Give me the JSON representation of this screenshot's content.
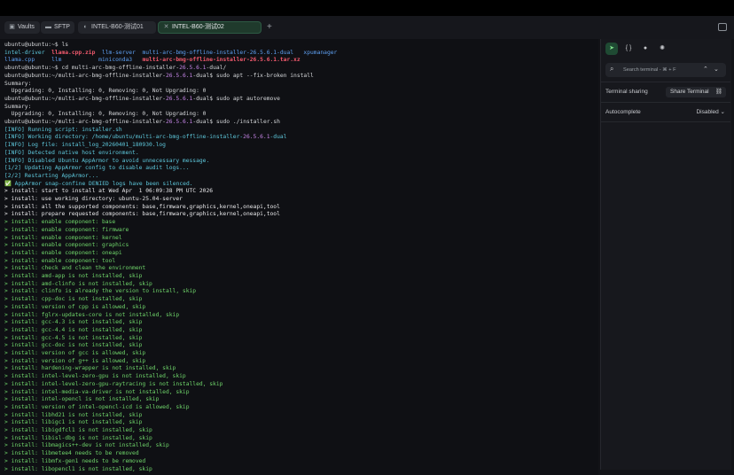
{
  "tabs": [
    {
      "icon": "vault-icon",
      "glyph": "▣",
      "label": "Vaults"
    },
    {
      "icon": "folder-icon",
      "glyph": "▬",
      "label": "SFTP"
    },
    {
      "icon": "terminal-icon",
      "glyph": "◐",
      "label": "INTEL-B60-测试01"
    },
    {
      "icon": "close-icon",
      "glyph": "✕",
      "label": "INTEL-B60-测试02"
    }
  ],
  "new_tab_glyph": "+",
  "terminal": {
    "lines": [
      [
        {
          "t": "ubuntu@ubuntu:~$ ls",
          "c": ""
        }
      ],
      [
        {
          "t": "intel-driver  ",
          "c": "c"
        },
        {
          "t": "llama.cpp.zip",
          "c": "r"
        },
        {
          "t": "  llm-server  ",
          "c": "b"
        },
        {
          "t": "multi-arc-bmg-offline-installer-26.5.6.1-dual",
          "c": "b"
        },
        {
          "t": "   xpumanager",
          "c": "b"
        }
      ],
      [
        {
          "t": "llama.cpp     ",
          "c": "b"
        },
        {
          "t": "llm",
          "c": "b"
        },
        {
          "t": "           miniconda3   ",
          "c": "b"
        },
        {
          "t": "multi-arc-bmg-offline-installer-26.5.6.1.tar.xz",
          "c": "r"
        }
      ],
      [
        {
          "t": "ubuntu@ubuntu:~$ cd multi-arc-bmg-offline-installer-",
          "c": ""
        },
        {
          "t": "26.5.6.1",
          "c": "m"
        },
        {
          "t": "-dual/",
          "c": ""
        }
      ],
      [
        {
          "t": "ubuntu@ubuntu:~/multi-arc-bmg-offline-installer-",
          "c": ""
        },
        {
          "t": "26.5.6.1",
          "c": "m"
        },
        {
          "t": "-dual$ sudo apt --fix-broken install",
          "c": ""
        }
      ],
      [
        {
          "t": "Summary:",
          "c": ""
        }
      ],
      [
        {
          "t": "  Upgrading: 0, Installing: 0, Removing: 0, Not Upgrading: 0",
          "c": ""
        }
      ],
      [
        {
          "t": "ubuntu@ubuntu:~/multi-arc-bmg-offline-installer-",
          "c": ""
        },
        {
          "t": "26.5.6.1",
          "c": "m"
        },
        {
          "t": "-dual$ sudo apt autoremove",
          "c": ""
        }
      ],
      [
        {
          "t": "Summary:",
          "c": ""
        }
      ],
      [
        {
          "t": "  Upgrading: 0, Installing: 0, Removing: 0, Not Upgrading: 0",
          "c": ""
        }
      ],
      [
        {
          "t": "ubuntu@ubuntu:~/multi-arc-bmg-offline-installer-",
          "c": ""
        },
        {
          "t": "26.5.6.1",
          "c": "m"
        },
        {
          "t": "-dual$ sudo ./installer.sh",
          "c": ""
        }
      ],
      [
        {
          "t": "[INFO] Running script: installer.sh",
          "c": "c"
        }
      ],
      [
        {
          "t": "[INFO] Working directory: /home/ubuntu/multi-arc-bmg-offline-installer-",
          "c": "c"
        },
        {
          "t": "26.5.6.1",
          "c": "m"
        },
        {
          "t": "-dual",
          "c": "c"
        }
      ],
      [
        {
          "t": "[INFO] Log file: install_log_20260401_180930.log",
          "c": "c"
        }
      ],
      [
        {
          "t": "[INFO] Detected native host environment.",
          "c": "c"
        }
      ],
      [
        {
          "t": "[INFO] Disabled Ubuntu AppArmor to avoid unnecessary message.",
          "c": "c"
        }
      ],
      [
        {
          "t": "[1/2] Updating AppArmor config to disable audit logs...",
          "c": "c"
        }
      ],
      [
        {
          "t": "[2/2] Restarting AppArmor...",
          "c": "c"
        }
      ],
      [
        {
          "t": "✅ AppArmor snap-confine DENIED logs have been silenced.",
          "c": "c"
        }
      ],
      [
        {
          "t": "> install: start to install at Wed Apr  1 06:09:38 PM UTC 2026",
          "c": "p"
        }
      ],
      [
        {
          "t": "> install: use working directory: ubuntu-25.04-server",
          "c": "p"
        }
      ],
      [
        {
          "t": "> install: all the supported components: base,firmware,graphics,kernel,oneapi,tool",
          "c": "p"
        }
      ],
      [
        {
          "t": "> install: prepare requested components: base,firmware,graphics,kernel,oneapi,tool",
          "c": "p"
        }
      ],
      [
        {
          "t": "> install: enable component: base",
          "c": "g"
        }
      ],
      [
        {
          "t": "> install: enable component: firmware",
          "c": "g"
        }
      ],
      [
        {
          "t": "> install: enable component: kernel",
          "c": "g"
        }
      ],
      [
        {
          "t": "> install: enable component: graphics",
          "c": "g"
        }
      ],
      [
        {
          "t": "> install: enable component: oneapi",
          "c": "g"
        }
      ],
      [
        {
          "t": "> install: enable component: tool",
          "c": "g"
        }
      ],
      [
        {
          "t": "> install: check and clean the environment",
          "c": "g"
        }
      ],
      [
        {
          "t": "> install: amd-app is not installed, skip",
          "c": "g"
        }
      ],
      [
        {
          "t": "> install: amd-clinfo is not installed, skip",
          "c": "g"
        }
      ],
      [
        {
          "t": "> install: clinfo is already the version to install, skip",
          "c": "g"
        }
      ],
      [
        {
          "t": "> install: cpp-doc is not installed, skip",
          "c": "g"
        }
      ],
      [
        {
          "t": "> install: version of cpp is allowed, skip",
          "c": "g"
        }
      ],
      [
        {
          "t": "> install: fglrx-updates-core is not installed, skip",
          "c": "g"
        }
      ],
      [
        {
          "t": "> install: gcc-4.3 is not installed, skip",
          "c": "g"
        }
      ],
      [
        {
          "t": "> install: gcc-4.4 is not installed, skip",
          "c": "g"
        }
      ],
      [
        {
          "t": "> install: gcc-4.5 is not installed, skip",
          "c": "g"
        }
      ],
      [
        {
          "t": "> install: gcc-doc is not installed, skip",
          "c": "g"
        }
      ],
      [
        {
          "t": "> install: version of gcc is allowed, skip",
          "c": "g"
        }
      ],
      [
        {
          "t": "> install: version of g++ is allowed, skip",
          "c": "g"
        }
      ],
      [
        {
          "t": "> install: hardening-wrapper is not installed, skip",
          "c": "g"
        }
      ],
      [
        {
          "t": "> install: intel-level-zero-gpu is not installed, skip",
          "c": "g"
        }
      ],
      [
        {
          "t": "> install: intel-level-zero-gpu-raytracing is not installed, skip",
          "c": "g"
        }
      ],
      [
        {
          "t": "> install: intel-media-va-driver is not installed, skip",
          "c": "g"
        }
      ],
      [
        {
          "t": "> install: intel-opencl is not installed, skip",
          "c": "g"
        }
      ],
      [
        {
          "t": "> install: version of intel-opencl-icd is allowed, skip",
          "c": "g"
        }
      ],
      [
        {
          "t": "> install: libhd21 is not installed, skip",
          "c": "g"
        }
      ],
      [
        {
          "t": "> install: libigc1 is not installed, skip",
          "c": "g"
        }
      ],
      [
        {
          "t": "> install: libigdfcl1 is not installed, skip",
          "c": "g"
        }
      ],
      [
        {
          "t": "> install: libisl-dbg is not installed, skip",
          "c": "g"
        }
      ],
      [
        {
          "t": "> install: libmagics++-dev is not installed, skip",
          "c": "g"
        }
      ],
      [
        {
          "t": "> install: libmetee4 needs to be removed",
          "c": "g"
        }
      ],
      [
        {
          "t": "> install: libmfx-gen1 needs to be removed",
          "c": "g"
        }
      ],
      [
        {
          "t": "> install: libopencl1 is not installed, skip",
          "c": "g"
        }
      ]
    ]
  },
  "side_panel": {
    "icons": [
      {
        "name": "send-icon",
        "glyph": "➤",
        "active": true
      },
      {
        "name": "code-icon",
        "glyph": "{ }",
        "active": false
      },
      {
        "name": "record-icon",
        "glyph": "●",
        "active": false
      },
      {
        "name": "openai-icon",
        "glyph": "✺",
        "active": false
      }
    ],
    "search_placeholder": "Search terminal - ⌘ + F",
    "terminal_sharing_label": "Terminal sharing",
    "share_terminal_label": "Share Terminal",
    "autocomplete_label": "Autocomplete",
    "autocomplete_value": "Disabled ⌄"
  }
}
